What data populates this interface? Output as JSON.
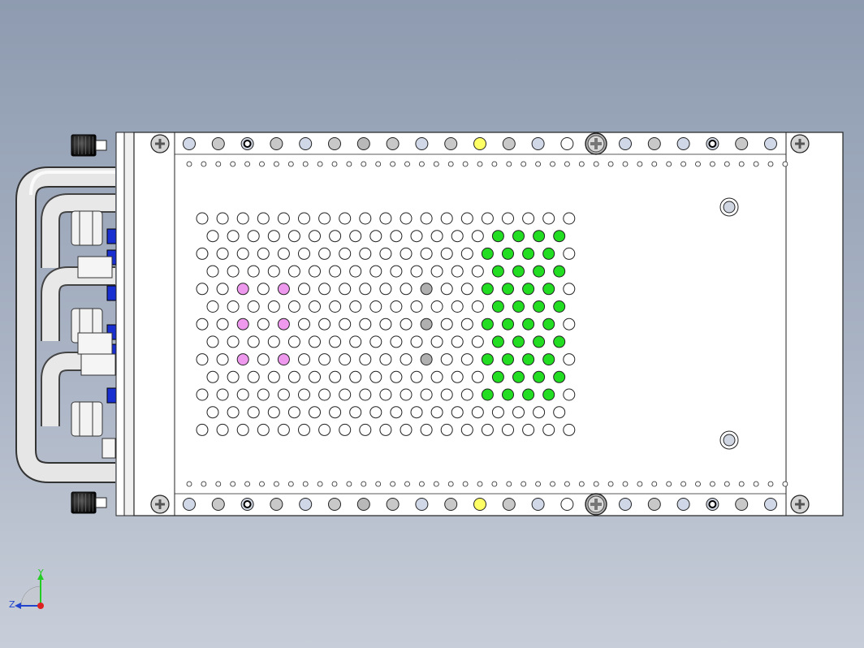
{
  "view": {
    "background_top": "#8e9bb0",
    "background_bottom": "#c8ced9",
    "panel_fill": "#ffffff",
    "edge_color": "#1a1a1a",
    "hole_colors": [
      "#ffffff",
      "#22dd22",
      "#ee99ee",
      "#b0b0b0",
      "#d0d8e8",
      "#aa2222",
      "#ffff66"
    ]
  },
  "triad": {
    "y_label": "Y",
    "z_label": "Z",
    "y_color": "#22cc22",
    "x_color": "#dd2222",
    "z_color": "#2244cc"
  }
}
